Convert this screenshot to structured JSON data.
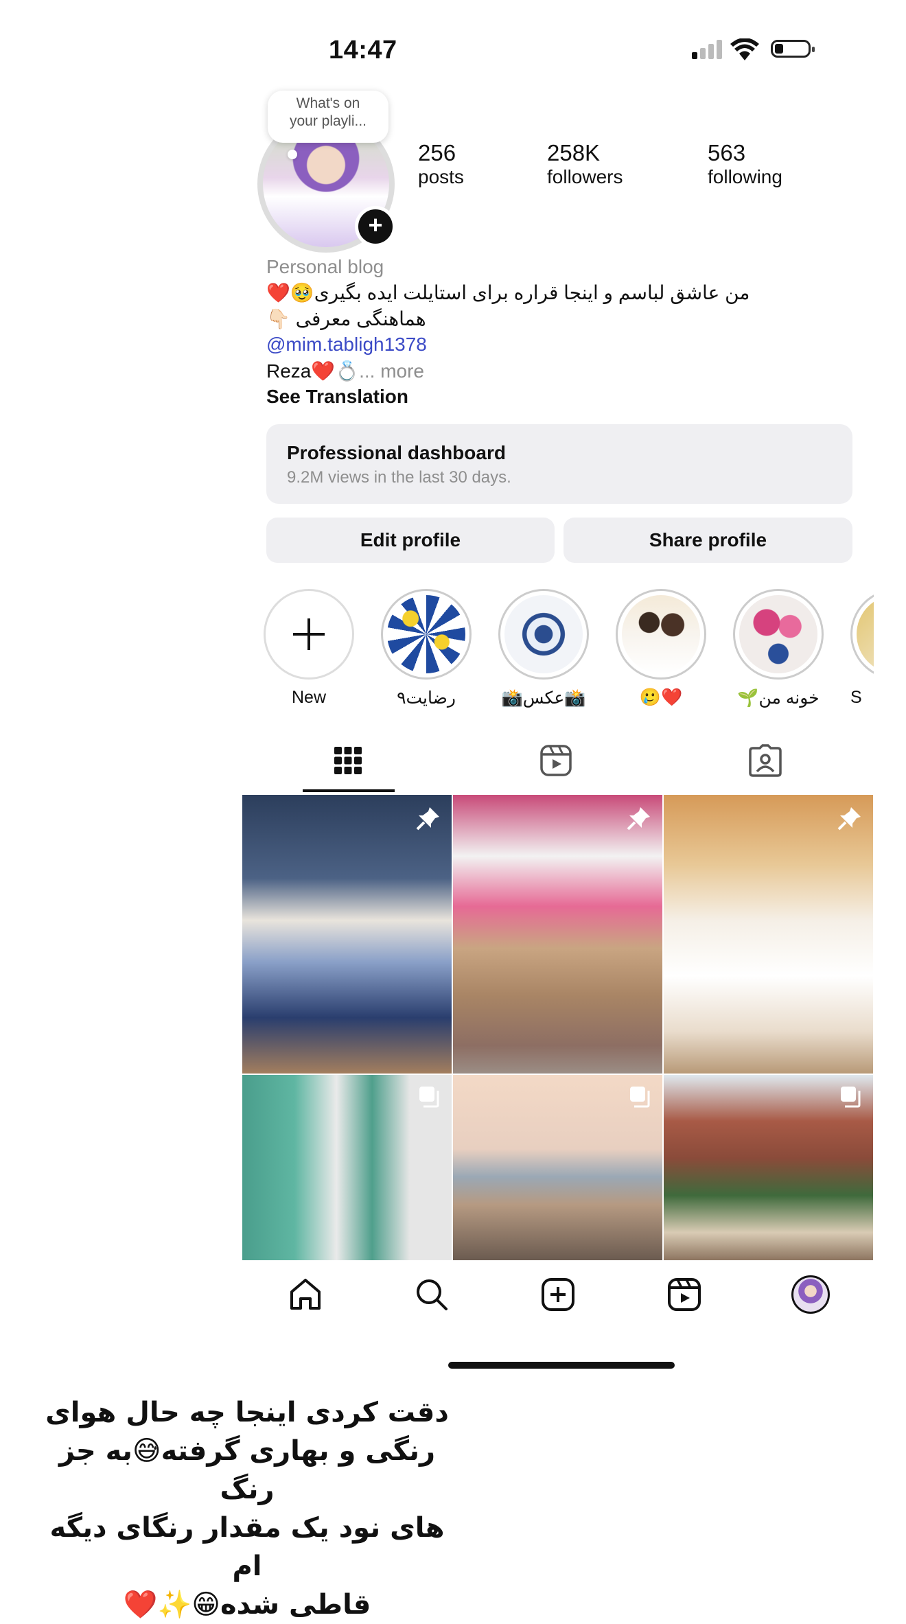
{
  "status_bar": {
    "time": "14:47"
  },
  "profile": {
    "note_bubble": {
      "line1": "What's on",
      "line2": "your playli..."
    },
    "stats": [
      {
        "value": "256",
        "label": "posts"
      },
      {
        "value": "258K",
        "label": "followers"
      },
      {
        "value": "563",
        "label": "following"
      }
    ],
    "category": "Personal blog",
    "bio_line1": "من عاشق لباسم و اینجا قراره برای استایلت ایده بگیری🥹❤️",
    "bio_line2": "هماهنگی معرفی 👇🏻",
    "mention": "@mim.tabligh1378",
    "bio_line4": "Reza❤️💍",
    "more": "... more",
    "see_translation": "See Translation"
  },
  "dashboard": {
    "title": "Professional dashboard",
    "subtitle": "9.2M views in the last 30 days."
  },
  "buttons": {
    "edit_profile": "Edit profile",
    "share_profile": "Share profile"
  },
  "highlights": [
    {
      "label": "New"
    },
    {
      "label": "رضایت۹"
    },
    {
      "label": "📸عکس📸"
    },
    {
      "label": "🥲❤️"
    },
    {
      "label": "🌱خونه من"
    },
    {
      "label": "S"
    }
  ],
  "tabs": [
    {
      "name": "grid",
      "icon": "grid-icon",
      "selected": true
    },
    {
      "name": "reels",
      "icon": "reels-icon",
      "selected": false
    },
    {
      "name": "tagged",
      "icon": "tagged-icon",
      "selected": false
    }
  ],
  "posts": [
    {
      "badge": "pin-icon"
    },
    {
      "badge": "pin-icon"
    },
    {
      "badge": "pin-icon"
    },
    {
      "badge": "carousel-icon"
    },
    {
      "badge": "carousel-icon"
    },
    {
      "badge": "carousel-icon"
    }
  ],
  "bottom_nav": [
    "home-icon",
    "search-icon",
    "create-icon",
    "reels-icon",
    "profile-avatar"
  ],
  "caption": {
    "line1": "دقت کردی اینجا چه حال هوای",
    "line2": "رنگی و بهاری گرفته😅به جز رنگ",
    "line3": "های نود یک مقدار رنگای دیگه ام",
    "line4": "قاطی شده😁✨❤️"
  }
}
